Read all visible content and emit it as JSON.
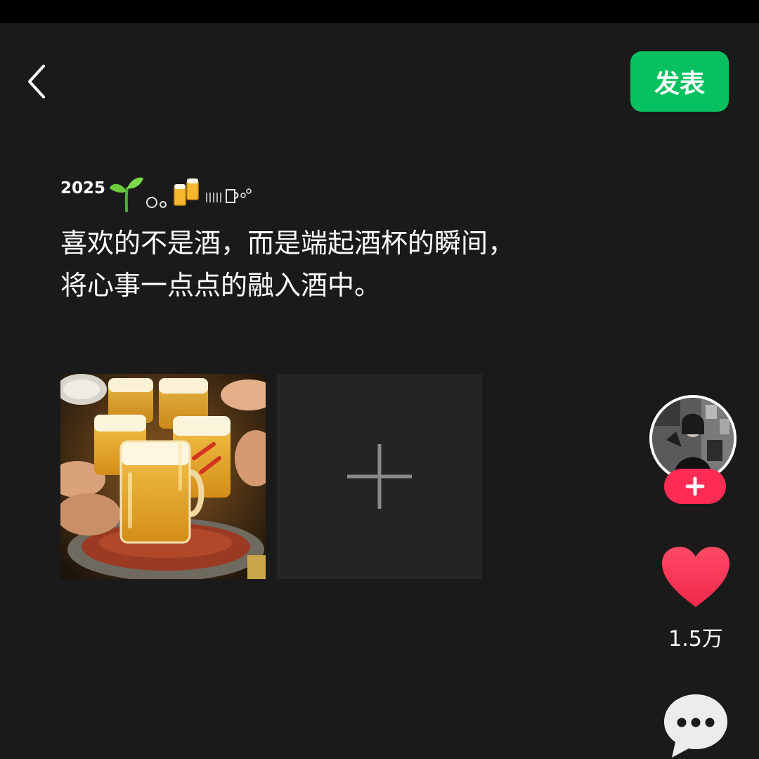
{
  "header": {
    "publish_label": "发表"
  },
  "post": {
    "year": "2025",
    "decor_emoji": [
      "sprout",
      "bubbles",
      "clinking-beer-mugs",
      "bubbles"
    ],
    "lines": [
      "喜欢的不是酒，而是端起酒杯的瞬间，",
      "将心事一点点的融入酒中。"
    ]
  },
  "media": {
    "add_icon": "plus-icon"
  },
  "sidebar": {
    "follow_icon": "plus-icon",
    "like_icon": "heart-icon",
    "like_count": "1.5万",
    "comment_icon": "comment-bubble-icon"
  },
  "colors": {
    "background": "#1a1a1a",
    "status_bar": "#000000",
    "publish_green": "#07c160",
    "follow_pink": "#fe2c55",
    "like_red": "#fe2c55",
    "placeholder": "#242424",
    "plus_gray": "#8a8a8a"
  }
}
